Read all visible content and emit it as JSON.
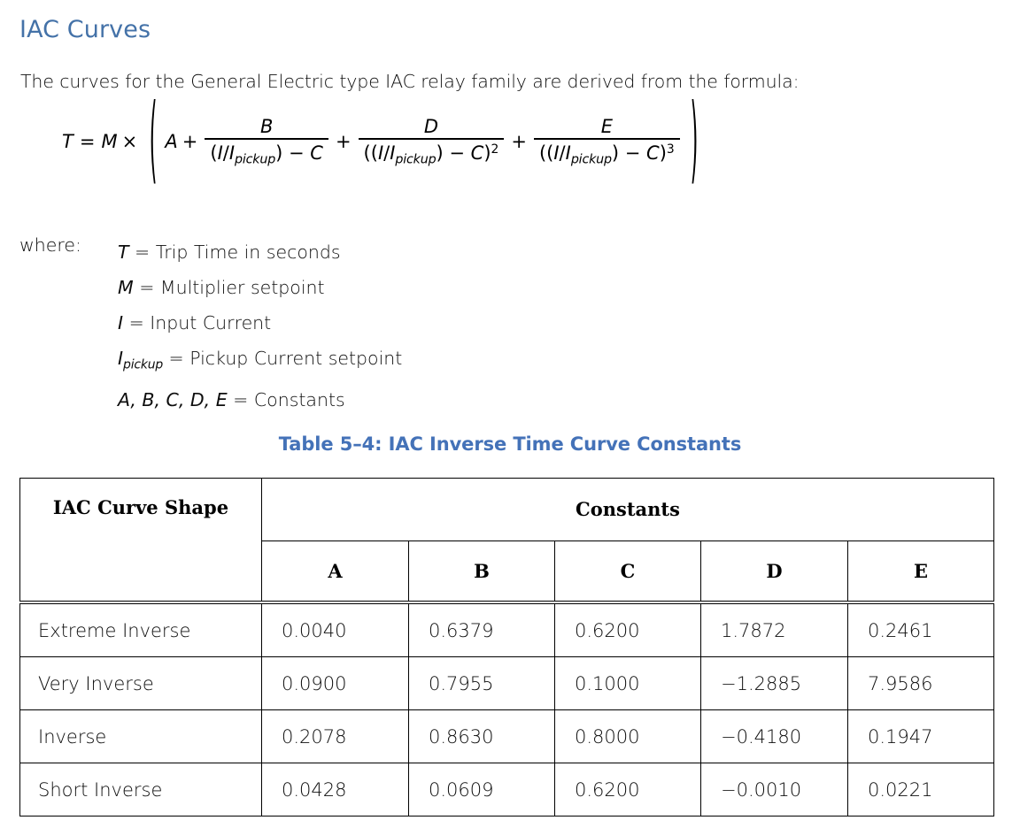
{
  "heading": "IAC Curves",
  "intro": "The curves for the General Electric type IAC relay family are derived from the formula:",
  "formula": {
    "lhs_var": "T",
    "equals": "=",
    "multiplier_var": "M",
    "times": "×",
    "open_paren": "(",
    "close_paren": ")",
    "term_a": "A",
    "plus": "+",
    "numerator_b": "B",
    "numerator_d": "D",
    "numerator_e": "E",
    "den_open": "(",
    "den_open2": "((",
    "den_ratio_i": "I",
    "den_slash": "/",
    "den_ratio_ip": "I",
    "den_sub": "pickup",
    "den_close": ")",
    "den_minus": "−",
    "den_c": "C",
    "den_close2": ")",
    "exp_2": "2",
    "exp_3": "3"
  },
  "where": {
    "label": "where:",
    "definitions": [
      {
        "symbol": "T",
        "sub": "",
        "text": " = Trip Time in seconds"
      },
      {
        "symbol": "M",
        "sub": "",
        "text": " = Multiplier setpoint"
      },
      {
        "symbol": "I",
        "sub": "",
        "text": " = Input Current"
      },
      {
        "symbol": "I",
        "sub": "pickup",
        "text": " = Pickup Current setpoint"
      },
      {
        "symbol": "A, B, C, D, E",
        "sub": "",
        "text": " = Constants"
      }
    ]
  },
  "table": {
    "caption": "Table 5–4: IAC Inverse Time Curve Constants",
    "header_shape": "IAC Curve Shape",
    "header_group": "Constants",
    "columns": [
      "A",
      "B",
      "C",
      "D",
      "E"
    ],
    "rows": [
      {
        "shape": "Extreme Inverse",
        "A": "0.0040",
        "B": "0.6379",
        "C": "0.6200",
        "D": "1.7872",
        "E": "0.2461"
      },
      {
        "shape": "Very Inverse",
        "A": "0.0900",
        "B": "0.7955",
        "C": "0.1000",
        "D": "−1.2885",
        "E": "7.9586"
      },
      {
        "shape": "Inverse",
        "A": "0.2078",
        "B": "0.8630",
        "C": "0.8000",
        "D": "−0.4180",
        "E": "0.1947"
      },
      {
        "shape": "Short Inverse",
        "A": "0.0428",
        "B": "0.0609",
        "C": "0.6200",
        "D": "−0.0010",
        "E": "0.0221"
      }
    ]
  },
  "colors": {
    "heading_blue": "#4472a8",
    "caption_blue": "#4472b8",
    "body_text": "#0d0d0d",
    "rule": "#000000"
  }
}
